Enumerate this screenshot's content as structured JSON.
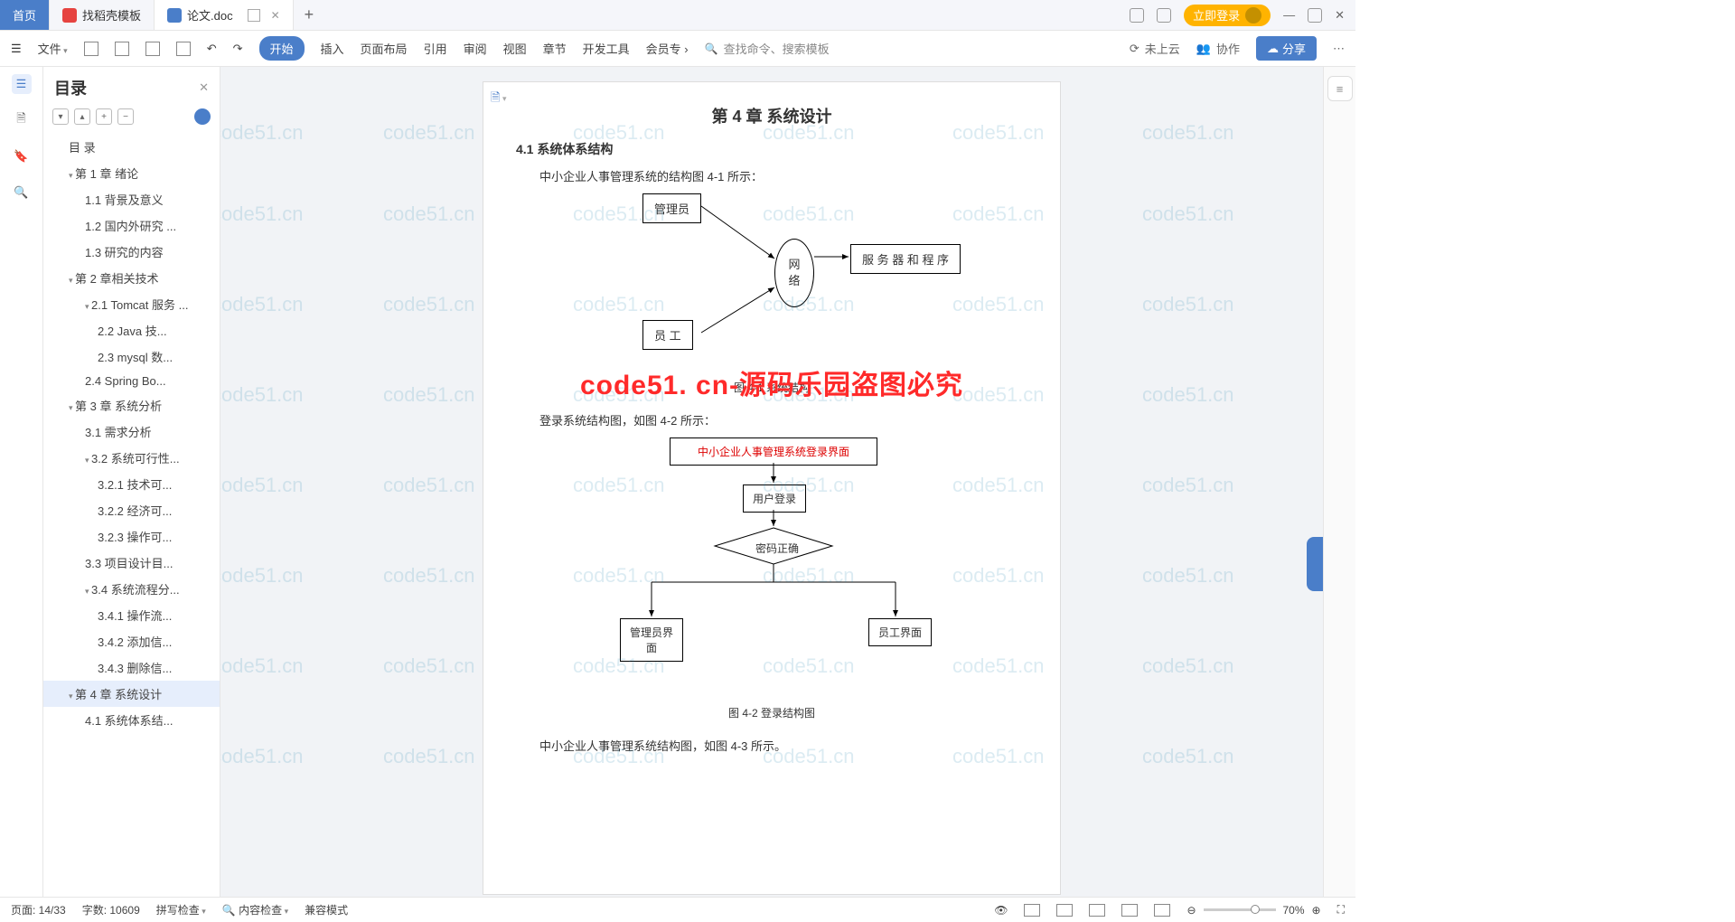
{
  "tabs": {
    "home": "首页",
    "template": "找稻壳模板",
    "doc": "论文.doc"
  },
  "topright": {
    "login": "立即登录"
  },
  "ribbon": {
    "file": "文件",
    "start": "开始",
    "insert": "插入",
    "layout": "页面布局",
    "ref": "引用",
    "review": "审阅",
    "view": "视图",
    "chapter": "章节",
    "dev": "开发工具",
    "member": "会员专",
    "search_ph": "查找命令、搜索模板",
    "cloud": "未上云",
    "collab": "协作",
    "share": "分享"
  },
  "outline": {
    "title": "目录",
    "items": [
      {
        "lvl": 1,
        "tw": false,
        "label": "目 录"
      },
      {
        "lvl": 1,
        "tw": true,
        "label": "第 1 章  绪论"
      },
      {
        "lvl": 2,
        "tw": false,
        "label": "1.1 背景及意义"
      },
      {
        "lvl": 2,
        "tw": false,
        "label": "1.2  国内外研究 ..."
      },
      {
        "lvl": 2,
        "tw": false,
        "label": "1.3 研究的内容"
      },
      {
        "lvl": 1,
        "tw": true,
        "label": "第 2 章相关技术"
      },
      {
        "lvl": 2,
        "tw": true,
        "label": "2.1 Tomcat 服务 ..."
      },
      {
        "lvl": 3,
        "tw": false,
        "label": "2.2    Java 技..."
      },
      {
        "lvl": 3,
        "tw": false,
        "label": "2.3 mysql 数..."
      },
      {
        "lvl": 2,
        "tw": false,
        "label": "2.4 Spring    Bo..."
      },
      {
        "lvl": 1,
        "tw": true,
        "label": "第 3 章  系统分析"
      },
      {
        "lvl": 2,
        "tw": false,
        "label": "3.1  需求分析"
      },
      {
        "lvl": 2,
        "tw": true,
        "label": "3.2  系统可行性..."
      },
      {
        "lvl": 3,
        "tw": false,
        "label": "3.2.1 技术可..."
      },
      {
        "lvl": 3,
        "tw": false,
        "label": "3.2.2 经济可..."
      },
      {
        "lvl": 3,
        "tw": false,
        "label": "3.2.3 操作可..."
      },
      {
        "lvl": 2,
        "tw": false,
        "label": "3.3 项目设计目..."
      },
      {
        "lvl": 2,
        "tw": true,
        "label": "3.4 系统流程分..."
      },
      {
        "lvl": 3,
        "tw": false,
        "label": "3.4.1 操作流..."
      },
      {
        "lvl": 3,
        "tw": false,
        "label": "3.4.2 添加信..."
      },
      {
        "lvl": 3,
        "tw": false,
        "label": "3.4.3 删除信..."
      },
      {
        "lvl": 1,
        "tw": true,
        "label": "第 4 章  系统设计",
        "active": true
      },
      {
        "lvl": 2,
        "tw": false,
        "label": "4.1  系统体系结..."
      }
    ]
  },
  "doc": {
    "h1": "第 4 章  系统设计",
    "h2": "4.1  系统体系结构",
    "p1": "中小企业人事管理系统的结构图 4-1 所示：",
    "d1": {
      "admin": "管理员",
      "emp": "员    工",
      "net1": "网",
      "net2": "络",
      "srv": "服 务 器 和 程 序"
    },
    "cap1": "图 4-1  系统结构",
    "p2": "登录系统结构图，如图 4-2 所示：",
    "d2": {
      "title": "中小企业人事管理系统登录界面",
      "login": "用户登录",
      "ok": "密码正确",
      "admin": "管理员界面",
      "emp": "员工界面"
    },
    "cap2": "图 4-2 登录结构图",
    "p3": "中小企业人事管理系统结构图，如图 4-3 所示。"
  },
  "watermark": {
    "big": "code51. cn-源码乐园盗图必究",
    "tile": "code51.cn"
  },
  "status": {
    "page": "页面: 14/33",
    "words": "字数: 10609",
    "spell": "拼写检查",
    "content": "内容检查",
    "compat": "兼容模式",
    "zoom": "70%"
  }
}
